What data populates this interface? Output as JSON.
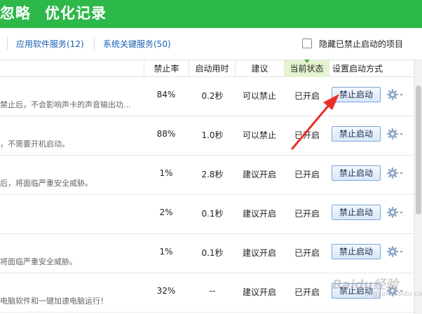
{
  "header": {
    "title_left": "忽略",
    "title_right": "优化记录"
  },
  "tabs": {
    "app_services": "应用软件服务(12)",
    "system_services": "系统关键服务(50)"
  },
  "filter": {
    "hide_disabled_label": "隐藏已禁止启动的项目"
  },
  "columns": {
    "disable_rate": "禁止率",
    "startup_time": "启动用时",
    "suggestion": "建议",
    "current_status": "当前状态",
    "startup_mode": "设置启动方式"
  },
  "rows": [
    {
      "desc": "禁止后，不会影响声卡的声音输出功...",
      "rate": "84%",
      "time": "0.2秒",
      "suggestion": "可以禁止",
      "status": "已开启",
      "action": "禁止启动"
    },
    {
      "desc": "，不需要开机启动。",
      "rate": "88%",
      "time": "1.0秒",
      "suggestion": "可以禁止",
      "status": "已开启",
      "action": "禁止启动"
    },
    {
      "desc": "后，将面临严重安全威胁。",
      "rate": "1%",
      "time": "2.8秒",
      "suggestion": "建议开启",
      "status": "已开启",
      "action": "禁止启动"
    },
    {
      "desc": "",
      "rate": "2%",
      "time": "0.1秒",
      "suggestion": "建议开启",
      "status": "已开启",
      "action": "禁止启动"
    },
    {
      "desc": "将面临严重安全威胁。",
      "rate": "1%",
      "time": "0.1秒",
      "suggestion": "建议开启",
      "status": "已开启",
      "action": "禁止启动"
    },
    {
      "desc": "电脑软件和一键加速电脑运行！",
      "rate": "32%",
      "time": "--",
      "suggestion": "建议开启",
      "status": "已开启",
      "action": "禁止启动"
    }
  ],
  "watermark": {
    "main": "Baidu经验",
    "sub": "jingyan.baidu.com"
  },
  "colors": {
    "header_green": "#2db84a",
    "link_blue": "#1a5fb4",
    "arrow_red": "#e8302a",
    "active_col": "#e4f4cf"
  },
  "icons": {
    "row_settings": "gear-icon",
    "dropdown": "chevron-down-icon",
    "annotation": "red-arrow"
  }
}
